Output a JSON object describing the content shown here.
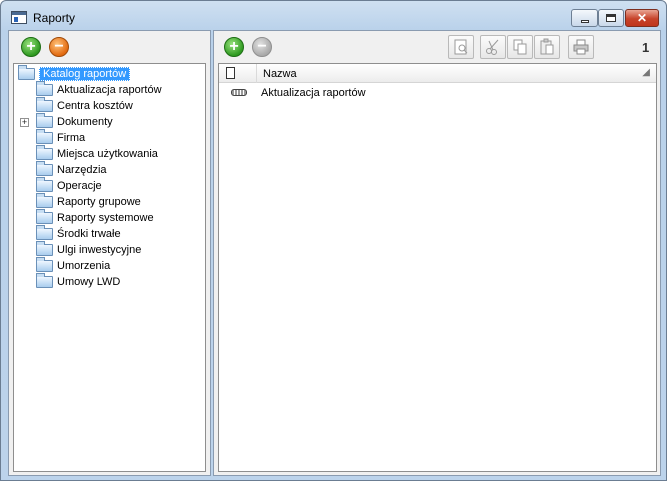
{
  "window": {
    "title": "Raporty",
    "close_glyph": "✕"
  },
  "left_toolbar": {
    "add_icon": "add-green-icon",
    "remove_icon": "remove-orange-icon",
    "add_symbol": "+",
    "remove_symbol": "−"
  },
  "tree": {
    "root": "Katalog raportów",
    "items": [
      "Aktualizacja raportów",
      "Centra kosztów",
      "Dokumenty",
      "Firma",
      "Miejsca użytkowania",
      "Narzędzia",
      "Operacje",
      "Raporty grupowe",
      "Raporty systemowe",
      "Środki trwałe",
      "Ulgi inwestycyjne",
      "Umorzenia",
      "Umowy LWD"
    ],
    "expandable_item": "Dokumenty",
    "expand_symbol": "+"
  },
  "right_toolbar": {
    "add_symbol": "+",
    "remove_symbol": "−",
    "page_number": "1"
  },
  "list": {
    "columns": {
      "name": "Nazwa"
    },
    "rows": [
      "Aktualizacja raportów"
    ]
  }
}
